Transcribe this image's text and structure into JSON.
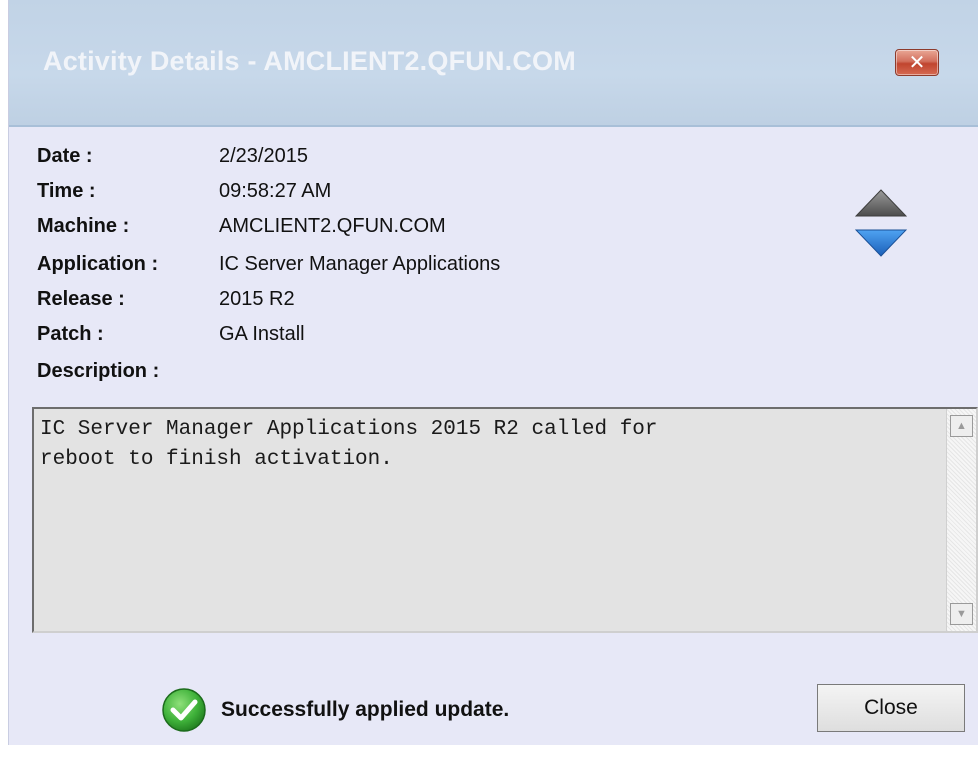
{
  "window": {
    "title": "Activity Details - AMCLIENT2.QFUN.COM",
    "close_glyph": "✕"
  },
  "details": {
    "date_label": "Date :",
    "date_value": "2/23/2015",
    "time_label": "Time :",
    "time_value": "09:58:27 AM",
    "machine_label": "Machine :",
    "machine_value": "AMCLIENT2.QFUN.COM",
    "application_label": "Application :",
    "application_value": "IC Server Manager Applications",
    "release_label": "Release :",
    "release_value": "2015 R2",
    "patch_label": "Patch :",
    "patch_value": "GA Install",
    "description_label": "Description :"
  },
  "description": {
    "text": "IC Server Manager Applications 2015 R2 called for\nreboot to finish activation."
  },
  "navigation": {
    "up_icon": "triangle-up-icon",
    "down_icon": "triangle-down-icon"
  },
  "status": {
    "icon": "check-circle-icon",
    "message": "Successfully applied update."
  },
  "footer": {
    "close_label": "Close"
  },
  "colors": {
    "title_bar": "#c4d6e9",
    "dialog_bg": "#e7e8f7",
    "success_green": "#3fb23a",
    "nav_down_blue": "#2e7fd8",
    "nav_up_gray": "#6f6f6f",
    "close_red": "#c9503a"
  }
}
